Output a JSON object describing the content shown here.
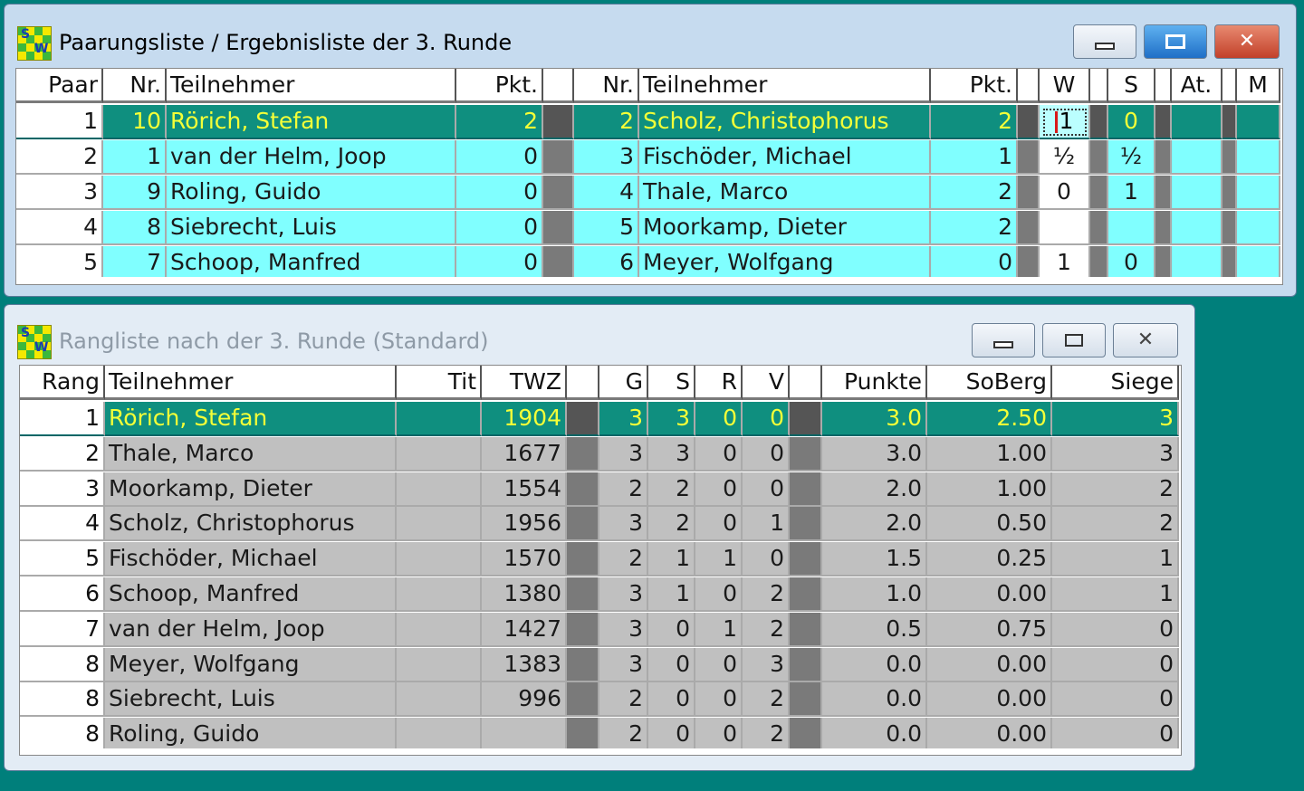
{
  "pairing": {
    "title": "Paarungsliste / Ergebnisliste der 3. Runde",
    "headers": {
      "paar": "Paar",
      "nr": "Nr.",
      "teilnehmer": "Teilnehmer",
      "pkt": "Pkt.",
      "nr2": "Nr.",
      "teilnehmer2": "Teilnehmer",
      "pkt2": "Pkt.",
      "w": "W",
      "s": "S",
      "at": "At.",
      "m": "M"
    },
    "rows": [
      {
        "paar": "1",
        "nr": "10",
        "name": "Rörich, Stefan",
        "pkt": "2",
        "nr2": "2",
        "name2": "Scholz, Christophorus",
        "pkt2": "2",
        "w": "1",
        "s": "0",
        "at": "",
        "m": ""
      },
      {
        "paar": "2",
        "nr": "1",
        "name": "van der Helm, Joop",
        "pkt": "0",
        "nr2": "3",
        "name2": "Fischöder, Michael",
        "pkt2": "1",
        "w": "½",
        "s": "½",
        "at": "",
        "m": ""
      },
      {
        "paar": "3",
        "nr": "9",
        "name": "Roling, Guido",
        "pkt": "0",
        "nr2": "4",
        "name2": "Thale, Marco",
        "pkt2": "2",
        "w": "0",
        "s": "1",
        "at": "",
        "m": ""
      },
      {
        "paar": "4",
        "nr": "8",
        "name": "Siebrecht, Luis",
        "pkt": "0",
        "nr2": "5",
        "name2": "Moorkamp, Dieter",
        "pkt2": "2",
        "w": "",
        "s": "",
        "at": "",
        "m": ""
      },
      {
        "paar": "5",
        "nr": "7",
        "name": "Schoop, Manfred",
        "pkt": "0",
        "nr2": "6",
        "name2": "Meyer, Wolfgang",
        "pkt2": "0",
        "w": "1",
        "s": "0",
        "at": "",
        "m": ""
      }
    ]
  },
  "ranking": {
    "title": "Rangliste nach der 3. Runde (Standard)",
    "headers": {
      "rang": "Rang",
      "teilnehmer": "Teilnehmer",
      "tit": "Tit",
      "twz": "TWZ",
      "g": "G",
      "s": "S",
      "r": "R",
      "v": "V",
      "punkte": "Punkte",
      "soberg": "SoBerg",
      "siege": "Siege"
    },
    "rows": [
      {
        "rang": "1",
        "name": "Rörich, Stefan",
        "tit": "",
        "twz": "1904",
        "g": "3",
        "s": "3",
        "r": "0",
        "v": "0",
        "punkte": "3.0",
        "soberg": "2.50",
        "siege": "3"
      },
      {
        "rang": "2",
        "name": "Thale, Marco",
        "tit": "",
        "twz": "1677",
        "g": "3",
        "s": "3",
        "r": "0",
        "v": "0",
        "punkte": "3.0",
        "soberg": "1.00",
        "siege": "3"
      },
      {
        "rang": "3",
        "name": "Moorkamp, Dieter",
        "tit": "",
        "twz": "1554",
        "g": "2",
        "s": "2",
        "r": "0",
        "v": "0",
        "punkte": "2.0",
        "soberg": "1.00",
        "siege": "2"
      },
      {
        "rang": "4",
        "name": "Scholz, Christophorus",
        "tit": "",
        "twz": "1956",
        "g": "3",
        "s": "2",
        "r": "0",
        "v": "1",
        "punkte": "2.0",
        "soberg": "0.50",
        "siege": "2"
      },
      {
        "rang": "5",
        "name": "Fischöder, Michael",
        "tit": "",
        "twz": "1570",
        "g": "2",
        "s": "1",
        "r": "1",
        "v": "0",
        "punkte": "1.5",
        "soberg": "0.25",
        "siege": "1"
      },
      {
        "rang": "6",
        "name": "Schoop, Manfred",
        "tit": "",
        "twz": "1380",
        "g": "3",
        "s": "1",
        "r": "0",
        "v": "2",
        "punkte": "1.0",
        "soberg": "0.00",
        "siege": "1"
      },
      {
        "rang": "7",
        "name": "van der Helm, Joop",
        "tit": "",
        "twz": "1427",
        "g": "3",
        "s": "0",
        "r": "1",
        "v": "2",
        "punkte": "0.5",
        "soberg": "0.75",
        "siege": "0"
      },
      {
        "rang": "8",
        "name": "Meyer, Wolfgang",
        "tit": "",
        "twz": "1383",
        "g": "3",
        "s": "0",
        "r": "0",
        "v": "3",
        "punkte": "0.0",
        "soberg": "0.00",
        "siege": "0"
      },
      {
        "rang": "8",
        "name": "Siebrecht, Luis",
        "tit": "",
        "twz": "996",
        "g": "2",
        "s": "0",
        "r": "0",
        "v": "2",
        "punkte": "0.0",
        "soberg": "0.00",
        "siege": "0"
      },
      {
        "rang": "8",
        "name": "Roling, Guido",
        "tit": "",
        "twz": "",
        "g": "2",
        "s": "0",
        "r": "0",
        "v": "2",
        "punkte": "0.0",
        "soberg": "0.00",
        "siege": "0"
      }
    ]
  },
  "app_icon_letters": {
    "top": "S",
    "bottom": "W"
  },
  "window_controls": {
    "minimize": "minimize-icon",
    "maximize": "maximize-icon",
    "close": "close-icon"
  },
  "colors": {
    "desktop": "#007f7b",
    "selected_row": "#0f8f7f",
    "selected_text": "#f4ff38",
    "row_cyan": "#80ffff",
    "row_gray": "#c0c0c0"
  }
}
